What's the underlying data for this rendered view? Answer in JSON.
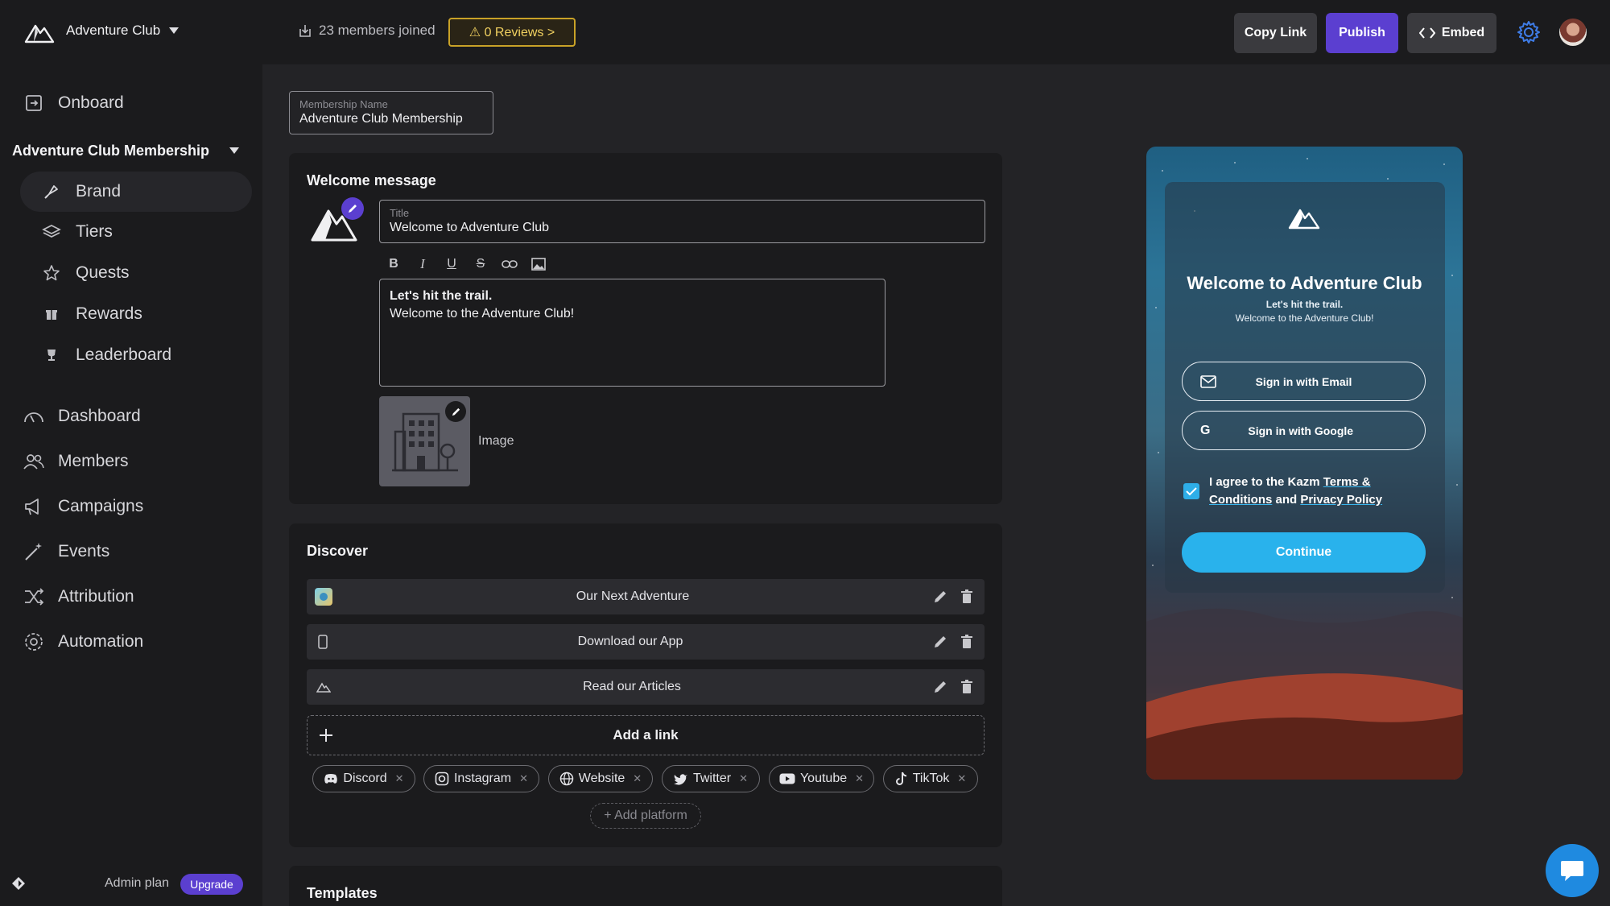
{
  "topbar": {
    "brand_name": "Adventure Club",
    "members_joined": "23 members joined",
    "reviews": "⚠ 0 Reviews >",
    "copy_link": "Copy Link",
    "publish": "Publish",
    "embed": "Embed"
  },
  "sidebar": {
    "onboard": "Onboard",
    "section_title": "Adventure Club Membership",
    "sub_items": [
      {
        "label": "Brand",
        "icon": "brush-icon"
      },
      {
        "label": "Tiers",
        "icon": "layers-icon"
      },
      {
        "label": "Quests",
        "icon": "star-icon"
      },
      {
        "label": "Rewards",
        "icon": "gift-icon"
      },
      {
        "label": "Leaderboard",
        "icon": "trophy-icon"
      }
    ],
    "main_items": [
      {
        "label": "Dashboard",
        "icon": "gauge-icon"
      },
      {
        "label": "Members",
        "icon": "users-icon"
      },
      {
        "label": "Campaigns",
        "icon": "megaphone-icon"
      },
      {
        "label": "Events",
        "icon": "wand-icon"
      },
      {
        "label": "Attribution",
        "icon": "shuffle-icon"
      },
      {
        "label": "Automation",
        "icon": "gear-icon"
      }
    ],
    "admin_plan": "Admin plan",
    "upgrade": "Upgrade"
  },
  "main": {
    "membership_name": {
      "label": "Membership Name",
      "value": "Adventure Club Membership"
    },
    "welcome": {
      "title": "Welcome message",
      "title_field": {
        "label": "Title",
        "value": "Welcome to Adventure Club"
      },
      "body_line1": "Let's hit the trail.",
      "body_line2": "Welcome to the Adventure Club!",
      "image_label": "Image"
    },
    "discover": {
      "title": "Discover",
      "links": [
        {
          "label": "Our Next Adventure"
        },
        {
          "label": "Download our App"
        },
        {
          "label": "Read our Articles"
        }
      ],
      "add_link": "Add a link",
      "platforms": [
        "Discord",
        "Instagram",
        "Website",
        "Twitter",
        "Youtube",
        "TikTok"
      ],
      "add_platform": "+ Add platform"
    },
    "templates_title": "Templates"
  },
  "preview": {
    "title": "Welcome to Adventure Club",
    "sub1": "Let's hit the trail.",
    "sub2": "Welcome to the Adventure Club!",
    "email_btn": "Sign in with Email",
    "google_btn": "Sign in with Google",
    "agree_prefix": "I agree to the Kazm",
    "terms": "Terms & Conditions",
    "and": "and",
    "privacy": "Privacy Policy",
    "continue": "Continue"
  },
  "colors": {
    "accent": "#5b3fd0",
    "preview_primary": "#29b2ec",
    "warning": "#c9a227"
  }
}
